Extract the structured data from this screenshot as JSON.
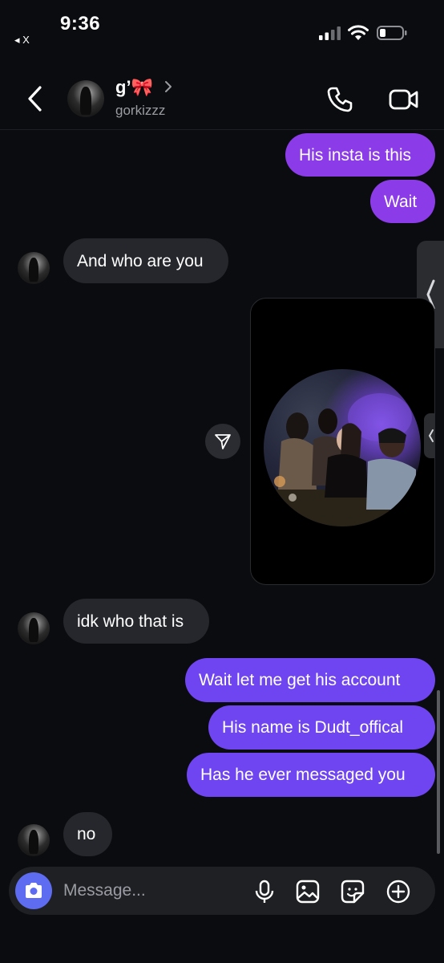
{
  "status": {
    "time": "9:36",
    "back_app": "◂ X"
  },
  "header": {
    "name": "g’🎀",
    "username": "gorkizzz"
  },
  "messages": [
    {
      "kind": "sent",
      "text": "His insta is this"
    },
    {
      "kind": "sent",
      "text": "Wait"
    },
    {
      "kind": "received",
      "text": "And who are you"
    },
    {
      "kind": "received",
      "text": "idk who that is"
    },
    {
      "kind": "sent",
      "text": "Wait let me get his account"
    },
    {
      "kind": "sent",
      "text": "His name is Dudt_offical"
    },
    {
      "kind": "sent",
      "text": "Has he ever messaged you"
    },
    {
      "kind": "received",
      "text": "no"
    }
  ],
  "composer": {
    "placeholder": "Message..."
  },
  "icons": {
    "back": "chevron-left-icon",
    "call": "phone-icon",
    "video": "video-camera-icon",
    "share": "send-icon",
    "camera": "camera-icon",
    "mic": "microphone-icon",
    "gallery": "image-icon",
    "sticker": "sticker-icon",
    "add": "plus-circle-icon"
  },
  "colors": {
    "sent_purple": "#8b3ce8",
    "sent_violet": "#6f45f2",
    "received": "#25272c",
    "background": "#0b0c0f",
    "camera_button": "#5e6cf2"
  }
}
